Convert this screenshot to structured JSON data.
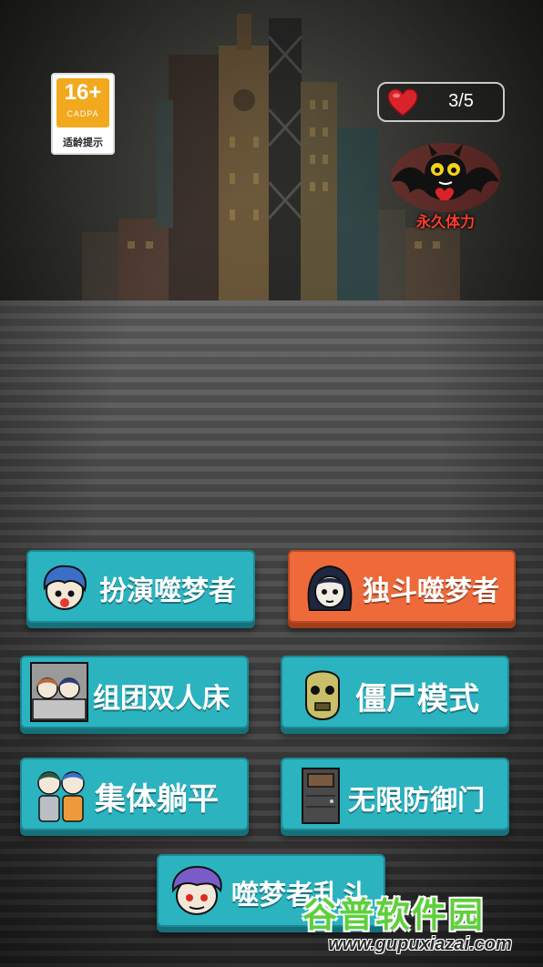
{
  "age_rating": {
    "number": "16+",
    "org": "CADPA",
    "tip": "适龄提示"
  },
  "stamina": {
    "count": "3/5"
  },
  "permanent_stamina": {
    "label": "永久体力"
  },
  "modes": [
    {
      "label": "扮演噬梦者",
      "color": "#2bb3c0"
    },
    {
      "label": "独斗噬梦者",
      "color": "#ee6a3a"
    },
    {
      "label": "组团双人床",
      "color": "#2bb3c0"
    },
    {
      "label": "僵尸模式",
      "color": "#2bb3c0"
    },
    {
      "label": "集体躺平",
      "color": "#2bb3c0"
    },
    {
      "label": "无限防御门",
      "color": "#2bb3c0"
    },
    {
      "label": "噬梦者乱斗",
      "color": "#2bb3c0"
    }
  ],
  "watermark": {
    "title": "谷普软件园",
    "url": "www.gupuxiazai.com"
  }
}
